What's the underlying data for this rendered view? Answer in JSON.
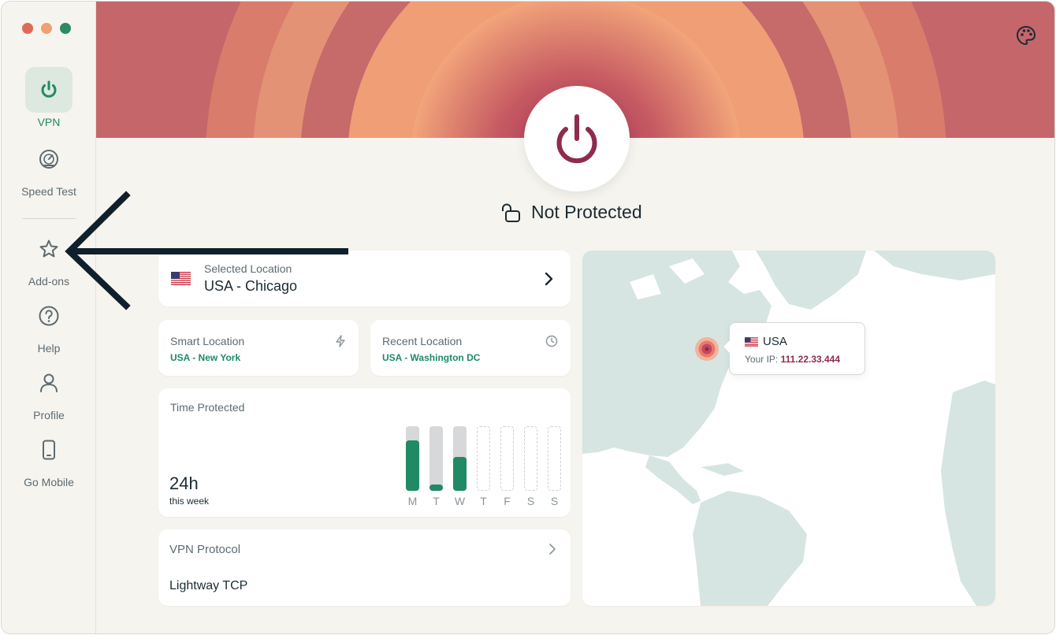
{
  "sidebar": {
    "items": [
      {
        "label": "VPN",
        "icon": "power-icon",
        "active": true
      },
      {
        "label": "Speed Test",
        "icon": "speedometer-icon"
      },
      {
        "label": "Add-ons",
        "icon": "star-icon"
      },
      {
        "label": "Help",
        "icon": "question-icon"
      },
      {
        "label": "Profile",
        "icon": "user-icon"
      },
      {
        "label": "Go Mobile",
        "icon": "phone-icon"
      }
    ]
  },
  "header": {
    "palette_icon": "palette-icon"
  },
  "status": {
    "text": "Not Protected"
  },
  "selected_location": {
    "label": "Selected Location",
    "value": "USA - Chicago"
  },
  "smart_location": {
    "label": "Smart Location",
    "value": "USA - New York",
    "icon": "lightning-icon"
  },
  "recent_location": {
    "label": "Recent Location",
    "value": "USA - Washington DC",
    "icon": "clock-icon"
  },
  "time_protected": {
    "label": "Time Protected",
    "total": "24h",
    "period": "this week",
    "days": [
      {
        "day": "M",
        "fraction": 0.78,
        "tracked": true
      },
      {
        "day": "T",
        "fraction": 0.1,
        "tracked": true
      },
      {
        "day": "W",
        "fraction": 0.52,
        "tracked": true
      },
      {
        "day": "T",
        "fraction": 0,
        "tracked": false
      },
      {
        "day": "F",
        "fraction": 0,
        "tracked": false
      },
      {
        "day": "S",
        "fraction": 0,
        "tracked": false
      },
      {
        "day": "S",
        "fraction": 0,
        "tracked": false
      }
    ]
  },
  "vpn_protocol": {
    "label": "VPN Protocol",
    "value": "Lightway TCP"
  },
  "map": {
    "country": "USA",
    "ip_label": "Your IP:",
    "ip": "111.22.33.444"
  },
  "colors": {
    "accent": "#1f8a64",
    "power": "#8e2c4a",
    "hero_top": "#f2a57a",
    "hero_center": "#a8385a"
  }
}
